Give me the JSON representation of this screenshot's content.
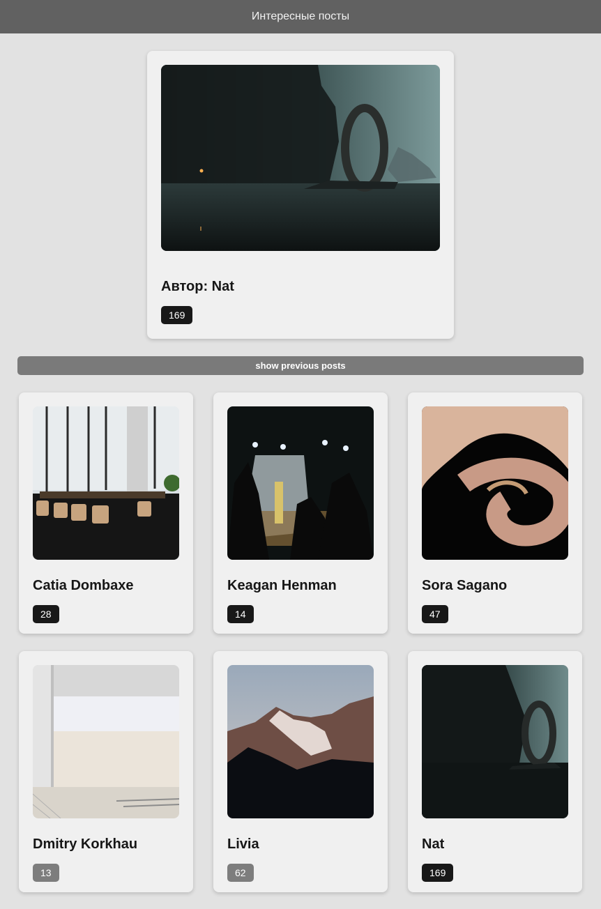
{
  "header": {
    "title": "Интересные посты"
  },
  "featured": {
    "author": "Автор: Nat",
    "count": "169",
    "badge_color": "#181818",
    "image": "portal-sea-image"
  },
  "show_previous": {
    "label": "show previous posts"
  },
  "grid": [
    {
      "name": "Catia Dombaxe",
      "count": "28",
      "badge": "dark",
      "image": "bar-interior-image"
    },
    {
      "name": "Keagan Henman",
      "count": "14",
      "badge": "dark",
      "image": "concert-image"
    },
    {
      "name": "Sora Sagano",
      "count": "47",
      "badge": "dark",
      "image": "flamingo-image"
    },
    {
      "name": "Dmitry Korkhau",
      "count": "13",
      "badge": "gray",
      "image": "garage-door-image"
    },
    {
      "name": "Livia",
      "count": "62",
      "badge": "gray",
      "image": "mountain-image"
    },
    {
      "name": "Nat",
      "count": "169",
      "badge": "dark",
      "image": "portal-sea-image"
    }
  ],
  "colors": {
    "header_bg": "#616161",
    "page_bg": "#e2e2e2",
    "card_bg": "#f0f0f0",
    "badge_dark": "#181818",
    "badge_gray": "#7d7d7d",
    "button_bg": "#7a7a7a"
  }
}
